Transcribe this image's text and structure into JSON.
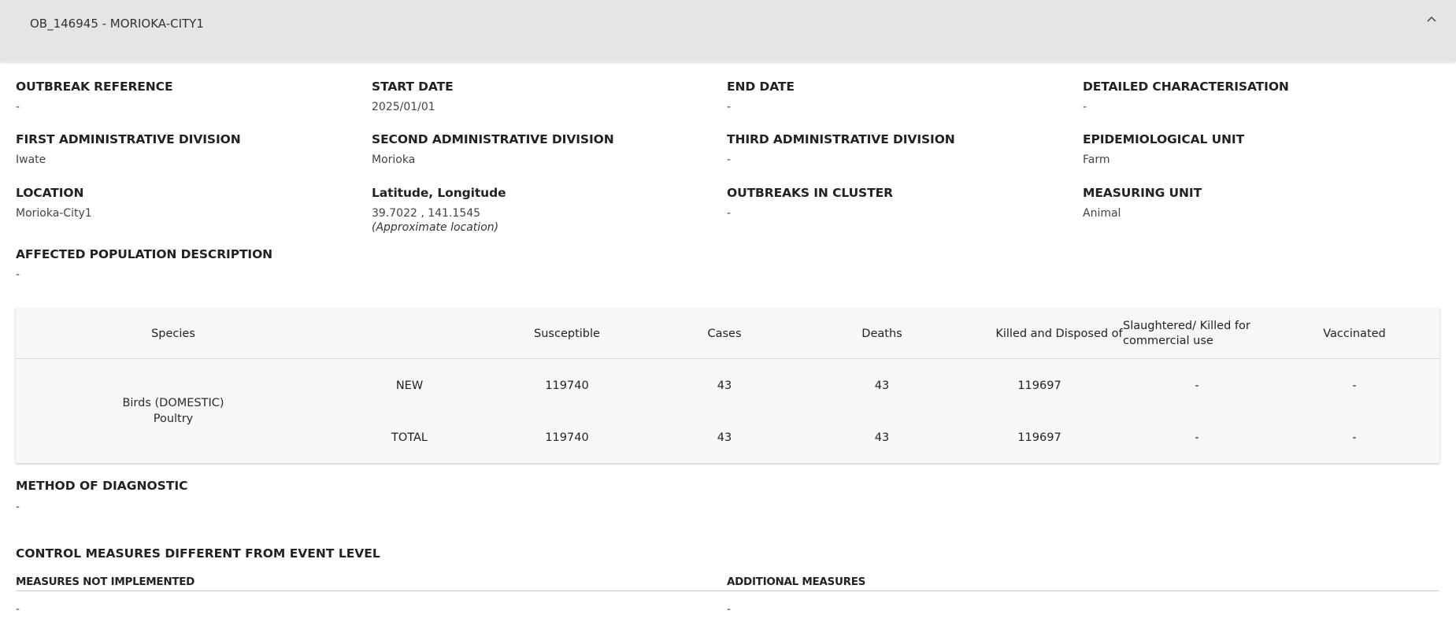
{
  "header": {
    "title": "OB_146945 - MORIOKA-CITY1"
  },
  "fields": {
    "outbreak_reference": {
      "label": "OUTBREAK REFERENCE",
      "value": "-"
    },
    "start_date": {
      "label": "START DATE",
      "value": "2025/01/01"
    },
    "end_date": {
      "label": "END DATE",
      "value": "-"
    },
    "detailed_characterisation": {
      "label": "DETAILED CHARACTERISATION",
      "value": "-"
    },
    "first_admin": {
      "label": "FIRST ADMINISTRATIVE DIVISION",
      "value": "Iwate"
    },
    "second_admin": {
      "label": "SECOND ADMINISTRATIVE DIVISION",
      "value": "Morioka"
    },
    "third_admin": {
      "label": "THIRD ADMINISTRATIVE DIVISION",
      "value": "-"
    },
    "epi_unit": {
      "label": "EPIDEMIOLOGICAL UNIT",
      "value": "Farm"
    },
    "location": {
      "label": "LOCATION",
      "value": "Morioka-City1"
    },
    "latlon": {
      "label": "Latitude, Longitude",
      "value": "39.7022 , 141.1545",
      "note": "(Approximate location)"
    },
    "outbreaks_in_cluster": {
      "label": "OUTBREAKS IN CLUSTER",
      "value": "-"
    },
    "measuring_unit": {
      "label": "MEASURING UNIT",
      "value": "Animal"
    },
    "affected_population": {
      "label": "AFFECTED POPULATION DESCRIPTION",
      "value": "-"
    }
  },
  "table": {
    "headers": {
      "species": "Species",
      "susceptible": "Susceptible",
      "cases": "Cases",
      "deaths": "Deaths",
      "killed": "Killed and Disposed of",
      "slaughtered": "Slaughtered/ Killed for commercial use",
      "vaccinated": "Vaccinated"
    },
    "species": {
      "line1": "Birds (DOMESTIC)",
      "line2": "Poultry"
    },
    "rows": [
      {
        "type": "NEW",
        "susceptible": "119740",
        "cases": "43",
        "deaths": "43",
        "killed": "119697",
        "slaughtered": "-",
        "vaccinated": "-"
      },
      {
        "type": "TOTAL",
        "susceptible": "119740",
        "cases": "43",
        "deaths": "43",
        "killed": "119697",
        "slaughtered": "-",
        "vaccinated": "-"
      }
    ]
  },
  "method_of_diagnostic": {
    "label": "METHOD OF DIAGNOSTIC",
    "value": "-"
  },
  "control_measures": {
    "title": "CONTROL MEASURES DIFFERENT FROM EVENT LEVEL",
    "not_implemented": {
      "label": "MEASURES NOT IMPLEMENTED",
      "value": "-"
    },
    "additional": {
      "label": "ADDITIONAL MEASURES",
      "value": "-"
    }
  }
}
